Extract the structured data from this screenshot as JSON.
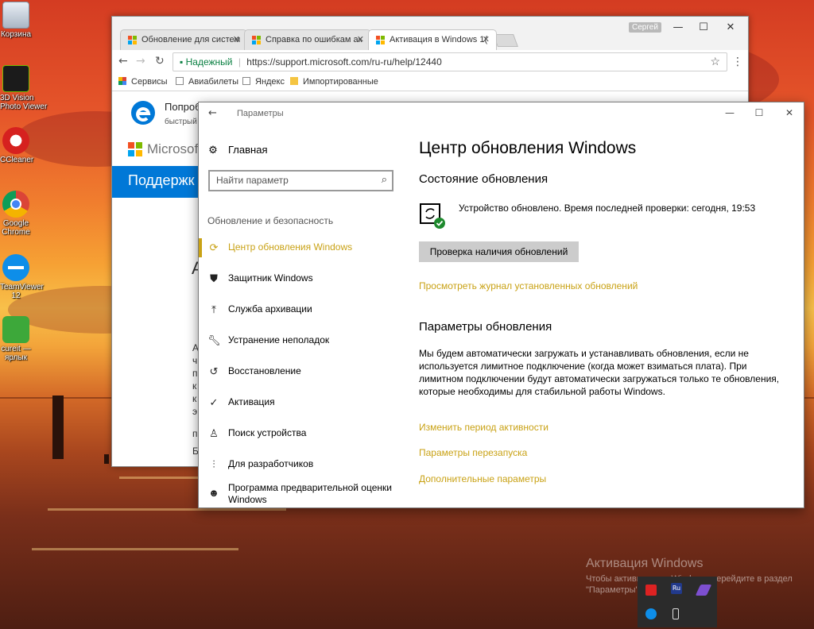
{
  "desktop": {
    "icons": [
      {
        "label": "Корзина"
      },
      {
        "label": "3D Vision\nPhoto Viewer"
      },
      {
        "label": "CCleaner"
      },
      {
        "label": "Google\nChrome"
      },
      {
        "label": "TeamViewer\n12"
      },
      {
        "label": "cureit —\nярлык"
      }
    ],
    "watermark_title": "Активация Windows",
    "watermark_text": "Чтобы активировать Windows, перейдите в раздел \"Параметры\".",
    "tray_icon_names": [
      "acrobat-icon",
      "ru-icon",
      "feather-icon",
      "teamviewer-icon",
      "usb-icon"
    ]
  },
  "browser": {
    "user": "Сергей",
    "tabs": [
      {
        "label": "Обновление для систем"
      },
      {
        "label": "Справка по ошибкам ак"
      },
      {
        "label": "Активация в Windows 1("
      }
    ],
    "secure_label": "Надежный",
    "url": "https://support.microsoft.com/ru-ru/help/12440",
    "bookmarks": [
      "Сервисы",
      "Авиабилеты",
      "Яндекс",
      "Импортированные"
    ],
    "page": {
      "promo_title": "Попробу",
      "promo_sub": "быстрый",
      "ms_wordmark": "Microsoft",
      "support_title": "Поддержк",
      "big_letter": "A",
      "fragments": [
        "А",
        "ч",
        "п",
        "к",
        "к",
        "э",
        "п",
        "Б"
      ]
    }
  },
  "settings": {
    "window_title": "Параметры",
    "home_label": "Главная",
    "search_placeholder": "Найти параметр",
    "category": "Обновление и безопасность",
    "nav": [
      {
        "label": "Центр обновления Windows",
        "icon": "refresh-icon",
        "active": true
      },
      {
        "label": "Защитник Windows",
        "icon": "shield-icon",
        "active": false
      },
      {
        "label": "Служба архивации",
        "icon": "upload-icon",
        "active": false
      },
      {
        "label": "Устранение неполадок",
        "icon": "wrench-icon",
        "active": false
      },
      {
        "label": "Восстановление",
        "icon": "history-icon",
        "active": false
      },
      {
        "label": "Активация",
        "icon": "check-circle-icon",
        "active": false
      },
      {
        "label": "Поиск устройства",
        "icon": "person-location-icon",
        "active": false
      },
      {
        "label": "Для разработчиков",
        "icon": "sliders-icon",
        "active": false
      },
      {
        "label": "Программа предварительной оценки\nWindows",
        "icon": "cat-icon",
        "active": false
      }
    ],
    "content": {
      "title": "Центр обновления Windows",
      "status_heading": "Состояние обновления",
      "status_text": "Устройство обновлено. Время последней проверки: сегодня, 19:53",
      "check_button": "Проверка наличия обновлений",
      "history_link": "Просмотреть журнал установленных обновлений",
      "options_heading": "Параметры обновления",
      "options_text": "Мы будем автоматически загружать и устанавливать обновления, если не используется лимитное подключение (когда может взиматься плата). При лимитном подключении будут автоматически загружаться только те обновления, которые необходимы для стабильной работы Windows.",
      "links": [
        "Изменить период активности",
        "Параметры перезапуска",
        "Дополнительные параметры"
      ]
    },
    "accent_color": "#c9a215"
  }
}
